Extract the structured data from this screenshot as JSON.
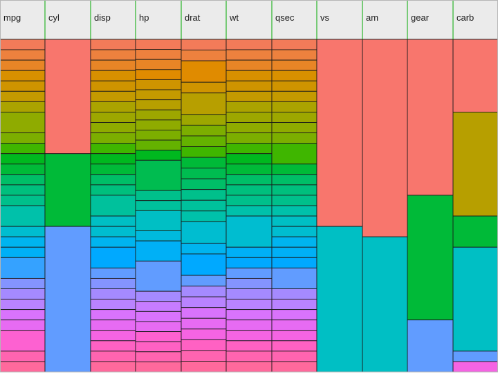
{
  "chart_data": {
    "type": "heatmap",
    "title": "",
    "columns": [
      {
        "name": "mpg",
        "counts": [
          1,
          1,
          1,
          1,
          1,
          1,
          1,
          2,
          1,
          1,
          1,
          1,
          1,
          1,
          1,
          2,
          1,
          1,
          1,
          2,
          1,
          1,
          1,
          1,
          1,
          2,
          1,
          1
        ]
      },
      {
        "name": "cyl",
        "counts": [
          11,
          7,
          14
        ]
      },
      {
        "name": "disp",
        "counts": [
          1,
          1,
          1,
          1,
          1,
          1,
          1,
          1,
          1,
          1,
          1,
          1,
          1,
          1,
          1,
          2,
          1,
          1,
          1,
          2,
          1,
          1,
          1,
          1,
          1,
          1,
          1,
          1,
          1,
          1
        ]
      },
      {
        "name": "hp",
        "counts": [
          1,
          1,
          1,
          1,
          1,
          1,
          1,
          1,
          1,
          1,
          1,
          1,
          3,
          1,
          1,
          2,
          1,
          2,
          3,
          1,
          1,
          1,
          1,
          1,
          1,
          1,
          1
        ]
      },
      {
        "name": "drat",
        "counts": [
          1,
          1,
          2,
          1,
          2,
          1,
          1,
          1,
          1,
          1,
          1,
          1,
          1,
          1,
          1,
          2,
          1,
          2,
          1,
          1,
          1,
          1,
          1,
          1,
          1,
          1,
          1
        ]
      },
      {
        "name": "wt",
        "counts": [
          1,
          1,
          1,
          1,
          1,
          1,
          1,
          1,
          1,
          1,
          1,
          1,
          1,
          1,
          1,
          1,
          1,
          3,
          1,
          1,
          1,
          1,
          1,
          1,
          1,
          1,
          1,
          1,
          1,
          1
        ]
      },
      {
        "name": "qsec",
        "counts": [
          1,
          1,
          1,
          1,
          1,
          1,
          1,
          1,
          1,
          1,
          2,
          1,
          1,
          1,
          1,
          1,
          1,
          1,
          1,
          1,
          1,
          2,
          1,
          1,
          1,
          1,
          1,
          1,
          1,
          1
        ]
      },
      {
        "name": "vs",
        "counts": [
          18,
          14
        ]
      },
      {
        "name": "am",
        "counts": [
          19,
          13
        ]
      },
      {
        "name": "gear",
        "counts": [
          15,
          12,
          5
        ]
      },
      {
        "name": "carb",
        "counts": [
          7,
          10,
          3,
          10,
          1,
          1
        ]
      }
    ],
    "palette": [
      "#f8766d",
      "#f37b59",
      "#ed813e",
      "#e88526",
      "#e08b00",
      "#d89000",
      "#cf9400",
      "#c49a00",
      "#b79f00",
      "#aba300",
      "#9da700",
      "#8fab00",
      "#7cae00",
      "#64b200",
      "#3fb600",
      "#00b81f",
      "#00ba38",
      "#00bc50",
      "#00be67",
      "#00bf7d",
      "#00c08b",
      "#00c19c",
      "#00c1aa",
      "#00bfc4",
      "#00bdd0",
      "#00bade",
      "#00b4ef",
      "#00b0f6",
      "#00a9ff",
      "#35a2ff",
      "#619cff",
      "#8494ff",
      "#a58aff",
      "#b983ff",
      "#c77cff",
      "#d973fc",
      "#e76bf3",
      "#f564e3",
      "#fd61d1",
      "#ff61c3",
      "#ff64b0",
      "#ff699c",
      "#fc6f86"
    ],
    "category_colors": {
      "cyl": [
        "#f8766d",
        "#00ba38",
        "#619cff"
      ],
      "vs": [
        "#f8766d",
        "#00bfc4"
      ],
      "am": [
        "#f8766d",
        "#00bfc4"
      ],
      "gear": [
        "#f8766d",
        "#00ba38",
        "#619cff"
      ],
      "carb": [
        "#f8766d",
        "#b79f00",
        "#00ba38",
        "#00bfc4",
        "#619cff",
        "#f564e3"
      ]
    },
    "header_color": "#ebebeb",
    "divider_color": "#00aa00",
    "grid": false,
    "legend": "none"
  }
}
